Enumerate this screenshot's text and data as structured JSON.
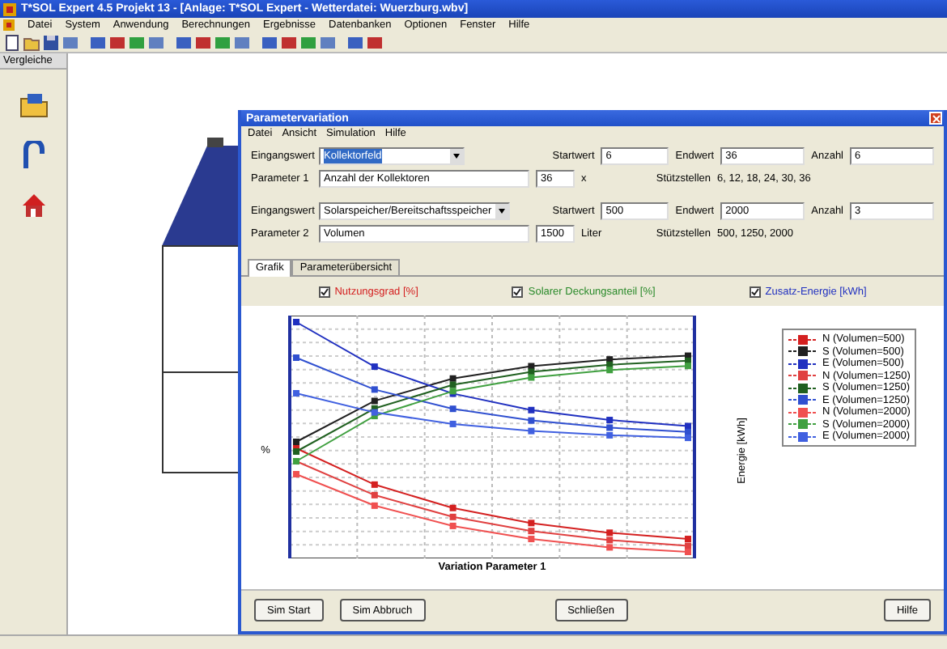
{
  "window": {
    "title": "T*SOL Expert 4.5 Projekt 13 - [Anlage: T*SOL Expert - Wetterdatei: Wuerzburg.wbv]"
  },
  "menu": [
    "Datei",
    "System",
    "Anwendung",
    "Berechnungen",
    "Ergebnisse",
    "Datenbanken",
    "Optionen",
    "Fenster",
    "Hilfe"
  ],
  "left_panel": {
    "title": "Vergleiche"
  },
  "dialog": {
    "title": "Parametervariation",
    "menu": [
      "Datei",
      "Ansicht",
      "Simulation",
      "Hilfe"
    ],
    "parameters": [
      {
        "input_label": "Eingangswert",
        "input_value": "Kollektorfeld",
        "highlighted": true,
        "start_label": "Startwert",
        "start": "6",
        "end_label": "Endwert",
        "end": "36",
        "count_label": "Anzahl",
        "count": "6",
        "param_label": "Parameter 1",
        "param_value": "Anzahl der Kollektoren",
        "current": "36",
        "unit": "x",
        "points_label": "Stützstellen",
        "points": "6, 12, 18, 24, 30, 36"
      },
      {
        "input_label": "Eingangswert",
        "input_value": "Solarspeicher/Bereitschaftsspeicher",
        "highlighted": false,
        "start_label": "Startwert",
        "start": "500",
        "end_label": "Endwert",
        "end": "2000",
        "count_label": "Anzahl",
        "count": "3",
        "param_label": "Parameter 2",
        "param_value": "Volumen",
        "current": "1500",
        "unit": "Liter",
        "points_label": "Stützstellen",
        "points": "500, 1250, 2000"
      }
    ],
    "tabs": [
      {
        "label": "Grafik",
        "selected": true
      },
      {
        "label": "Parameterübersicht",
        "selected": false
      }
    ],
    "toggles": [
      {
        "label": "Nutzungsgrad [%]",
        "checked": true,
        "color": "#d42020"
      },
      {
        "label": "Solarer Deckungsanteil [%]",
        "checked": true,
        "color": "#2a8a2a"
      },
      {
        "label": "Zusatz-Energie [kWh]",
        "checked": true,
        "color": "#2030c0"
      }
    ],
    "chart": {
      "ylabel": "%",
      "y2label": "Energie [kWh]",
      "xlabel": "Variation Parameter 1",
      "legend": [
        {
          "label": "N (Volumen=500)",
          "color": "#d42020"
        },
        {
          "label": "S (Volumen=500)",
          "color": "#202020"
        },
        {
          "label": "E (Volumen=500)",
          "color": "#2030c0"
        },
        {
          "label": "N (Volumen=1250)",
          "color": "#e04040"
        },
        {
          "label": "S (Volumen=1250)",
          "color": "#206020"
        },
        {
          "label": "E (Volumen=1250)",
          "color": "#3050d0"
        },
        {
          "label": "N (Volumen=2000)",
          "color": "#f05050"
        },
        {
          "label": "S (Volumen=2000)",
          "color": "#40a040"
        },
        {
          "label": "E (Volumen=2000)",
          "color": "#4060e0"
        }
      ]
    },
    "buttons": [
      "Sim Start",
      "Sim Abbruch",
      "Schließen",
      "Hilfe"
    ]
  }
}
